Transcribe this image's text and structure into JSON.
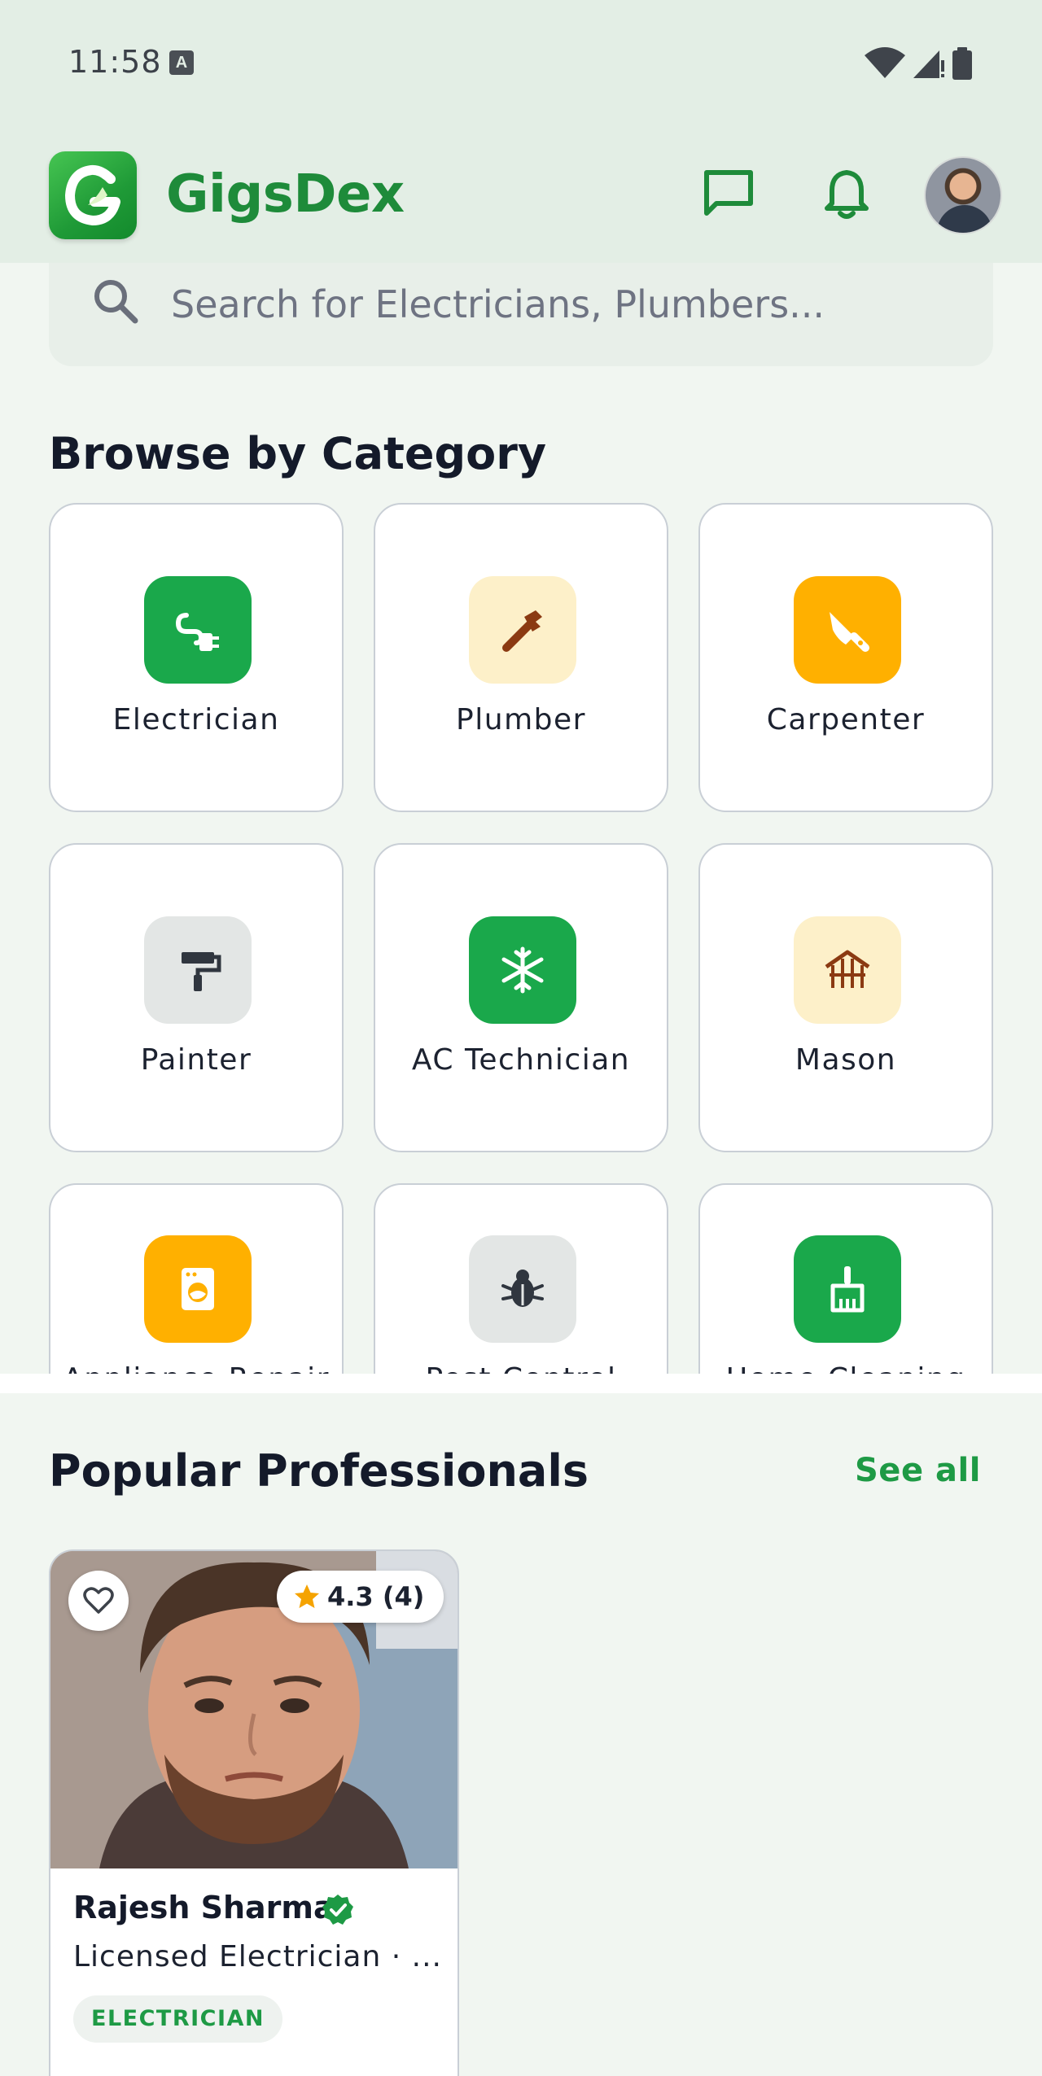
{
  "status_bar": {
    "time": "11:58",
    "indicator": "A"
  },
  "app_bar": {
    "title": "GigsDex",
    "icons": [
      "gigsdex-logo-icon",
      "chat-icon",
      "bell-icon",
      "avatar"
    ]
  },
  "search": {
    "placeholder": "Search for Electricians, Plumbers..."
  },
  "categories": {
    "title": "Browse by Category",
    "items": [
      {
        "label": "Electrician",
        "icon": "plug-icon",
        "color": "#1aa84b"
      },
      {
        "label": "Plumber",
        "icon": "pipe-wrench-icon",
        "color": "#fdf0c9"
      },
      {
        "label": "Carpenter",
        "icon": "saw-icon",
        "color": "#ffb000"
      },
      {
        "label": "Painter",
        "icon": "paint-roller-icon",
        "color": "#e3e6e5"
      },
      {
        "label": "AC Technician",
        "icon": "snowflake-icon",
        "color": "#1aa84b"
      },
      {
        "label": "Mason",
        "icon": "brick-house-icon",
        "color": "#fdf0c9"
      },
      {
        "label": "Appliance Repair",
        "icon": "washing-machine-icon",
        "color": "#ffb000"
      },
      {
        "label": "Pest Control",
        "icon": "bug-icon",
        "color": "#e3e6e5"
      },
      {
        "label": "Home Cleaning",
        "icon": "broom-icon",
        "color": "#1aa84b"
      }
    ]
  },
  "popular": {
    "title": "Popular Professionals",
    "see_all": "See all",
    "pros": [
      {
        "name": "Rajesh Sharma",
        "verified": true,
        "subtitle": "Licensed Electrician · ...",
        "rating": "4.3 (4)",
        "tag": "ELECTRICIAN"
      }
    ]
  },
  "colors": {
    "brand": "#1e8b3a",
    "accent": "#1e9a45",
    "star": "#f5a300"
  }
}
